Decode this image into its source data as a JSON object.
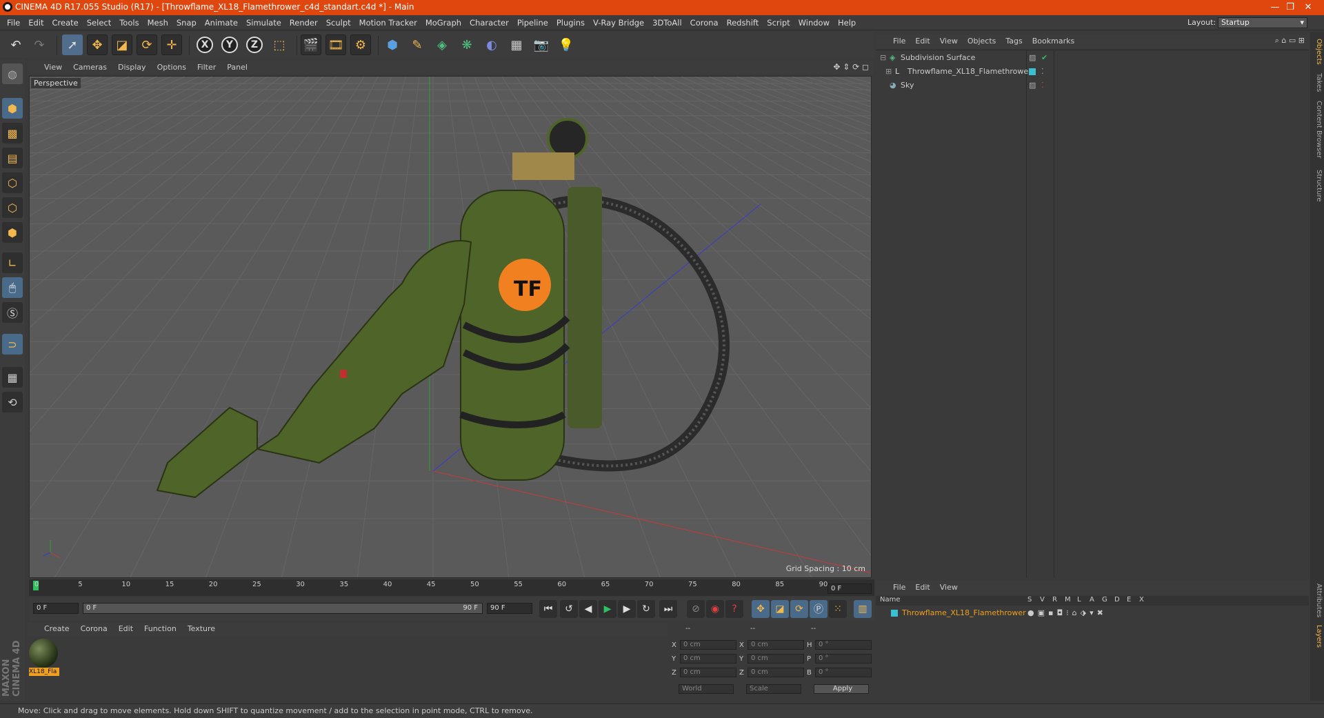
{
  "window": {
    "title": "CINEMA 4D R17.055 Studio (R17) - [Throwflame_XL18_Flamethrower_c4d_standart.c4d *] - Main",
    "minimize": "—",
    "maximize": "❐",
    "close": "✕"
  },
  "menubar": [
    "File",
    "Edit",
    "Create",
    "Select",
    "Tools",
    "Mesh",
    "Snap",
    "Animate",
    "Simulate",
    "Render",
    "Sculpt",
    "Motion Tracker",
    "MoGraph",
    "Character",
    "Pipeline",
    "Plugins",
    "V-Ray Bridge",
    "3DToAll",
    "Corona",
    "Redshift",
    "Script",
    "Window",
    "Help"
  ],
  "layout": {
    "label": "Layout:",
    "value": "Startup"
  },
  "viewport": {
    "menu": [
      "View",
      "Cameras",
      "Display",
      "Options",
      "Filter",
      "Panel"
    ],
    "label": "Perspective",
    "grid_spacing": "Grid Spacing : 10 cm",
    "colors": {
      "background": "#5a5a5a",
      "x_axis": "#c83a3a",
      "y_axis": "#2fa02f",
      "z_axis": "#3a3ad0",
      "object": "#4f6428"
    }
  },
  "timeline": {
    "ticks": [
      "0",
      "5",
      "10",
      "15",
      "20",
      "25",
      "30",
      "35",
      "40",
      "45",
      "50",
      "55",
      "60",
      "65",
      "70",
      "75",
      "80",
      "85",
      "90"
    ],
    "current_frame": "0 F",
    "start_field": "0 F",
    "range_start": "0 F",
    "range_end": "90 F",
    "end_field": "90 F"
  },
  "material_manager": {
    "menu": [
      "Create",
      "Corona",
      "Edit",
      "Function",
      "Texture"
    ],
    "material_name": "XL18_Fla"
  },
  "coordinates": {
    "header": [
      "--",
      "--",
      "--"
    ],
    "rows": [
      {
        "a": "X",
        "av": "0 cm",
        "b": "X",
        "bv": "0 cm",
        "c": "H",
        "cv": "0 °"
      },
      {
        "a": "Y",
        "av": "0 cm",
        "b": "Y",
        "bv": "0 cm",
        "c": "P",
        "cv": "0 °"
      },
      {
        "a": "Z",
        "av": "0 cm",
        "b": "Z",
        "bv": "0 cm",
        "c": "B",
        "cv": "0 °"
      }
    ],
    "space": "World",
    "mode": "Scale",
    "apply": "Apply"
  },
  "object_manager": {
    "menu": [
      "File",
      "Edit",
      "View",
      "Objects",
      "Tags",
      "Bookmarks"
    ],
    "objects": [
      {
        "name": "Subdivision Surface",
        "icon": "subdivision-icon"
      },
      {
        "name": "Throwflame_XL18_Flamethrower",
        "icon": "null-object-icon"
      },
      {
        "name": "Sky",
        "icon": "sky-icon"
      }
    ]
  },
  "layer_manager": {
    "menu": [
      "File",
      "Edit",
      "View"
    ],
    "columns": [
      "Name",
      "S",
      "V",
      "R",
      "M",
      "L",
      "A",
      "G",
      "D",
      "E",
      "X"
    ],
    "layer_name": "Throwflame_XL18_Flamethrower"
  },
  "side_tabs": [
    "Objects",
    "Takes",
    "Content Browser",
    "Structure",
    "Attributes",
    "Layers"
  ],
  "status": "Move: Click and drag to move elements. Hold down SHIFT to quantize movement / add to the selection in point mode, CTRL to remove.",
  "logo": "MAXON CINEMA 4D"
}
